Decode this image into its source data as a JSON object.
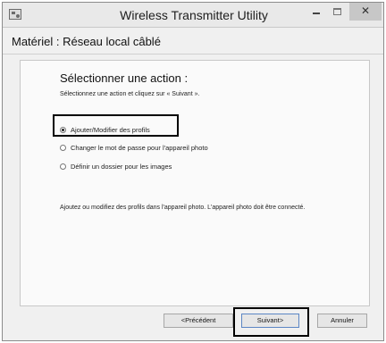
{
  "window": {
    "title": "Wireless Transmitter Utility",
    "minimize_icon": "minimize-icon",
    "maximize_icon": "maximize-icon",
    "close_label": "✕"
  },
  "header": {
    "title": "Matériel : Réseau local câblé"
  },
  "main": {
    "heading": "Sélectionner une action :",
    "instruction": "Sélectionnez une action et cliquez sur « Suivant ».",
    "options": [
      {
        "label": "Ajouter/Modifier des profils",
        "selected": true
      },
      {
        "label": "Changer le mot de passe pour l'appareil photo",
        "selected": false
      },
      {
        "label": "Définir un dossier pour les images",
        "selected": false
      }
    ],
    "description": "Ajoutez ou modifiez des profils dans l'appareil photo. L'appareil photo doit être connecté."
  },
  "footer": {
    "prev_label": "<Précédent",
    "next_label": "Suivant>",
    "cancel_label": "Annuler"
  },
  "colors": {
    "window_bg": "#f0f0f0",
    "panel_bg": "#fafafa",
    "close_button_bg": "#c7c7c7",
    "highlight_border": "#000000"
  }
}
